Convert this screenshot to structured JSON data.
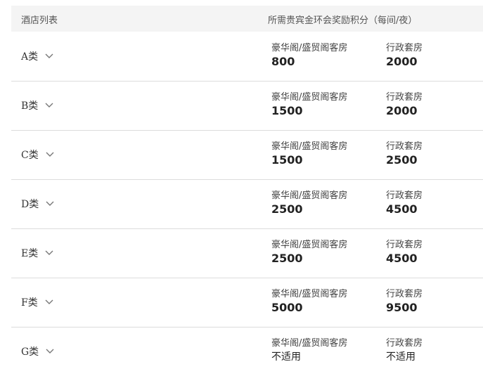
{
  "header": {
    "col_name": "酒店列表",
    "col_points": "所需贵宾金环会奖励积分（每间/夜）"
  },
  "rows": [
    {
      "category": "A类",
      "c1_label": "豪华阁/盛贸阁客房",
      "c1_value": "800",
      "c2_label": "行政套房",
      "c2_value": "2000"
    },
    {
      "category": "B类",
      "c1_label": "豪华阁/盛贸阁客房",
      "c1_value": "1500",
      "c2_label": "行政套房",
      "c2_value": "2000"
    },
    {
      "category": "C类",
      "c1_label": "豪华阁/盛贸阁客房",
      "c1_value": "1500",
      "c2_label": "行政套房",
      "c2_value": "2500"
    },
    {
      "category": "D类",
      "c1_label": "豪华阁/盛贸阁客房",
      "c1_value": "2500",
      "c2_label": "行政套房",
      "c2_value": "4500"
    },
    {
      "category": "E类",
      "c1_label": "豪华阁/盛贸阁客房",
      "c1_value": "2500",
      "c2_label": "行政套房",
      "c2_value": "4500"
    },
    {
      "category": "F类",
      "c1_label": "豪华阁/盛贸阁客房",
      "c1_value": "5000",
      "c2_label": "行政套房",
      "c2_value": "9500"
    },
    {
      "category": "G类",
      "c1_label": "豪华阁/盛贸阁客房",
      "c1_value": "不适用",
      "c2_label": "行政套房",
      "c2_value": "不适用"
    }
  ],
  "icons": {
    "expand": "chevron-down-icon"
  }
}
